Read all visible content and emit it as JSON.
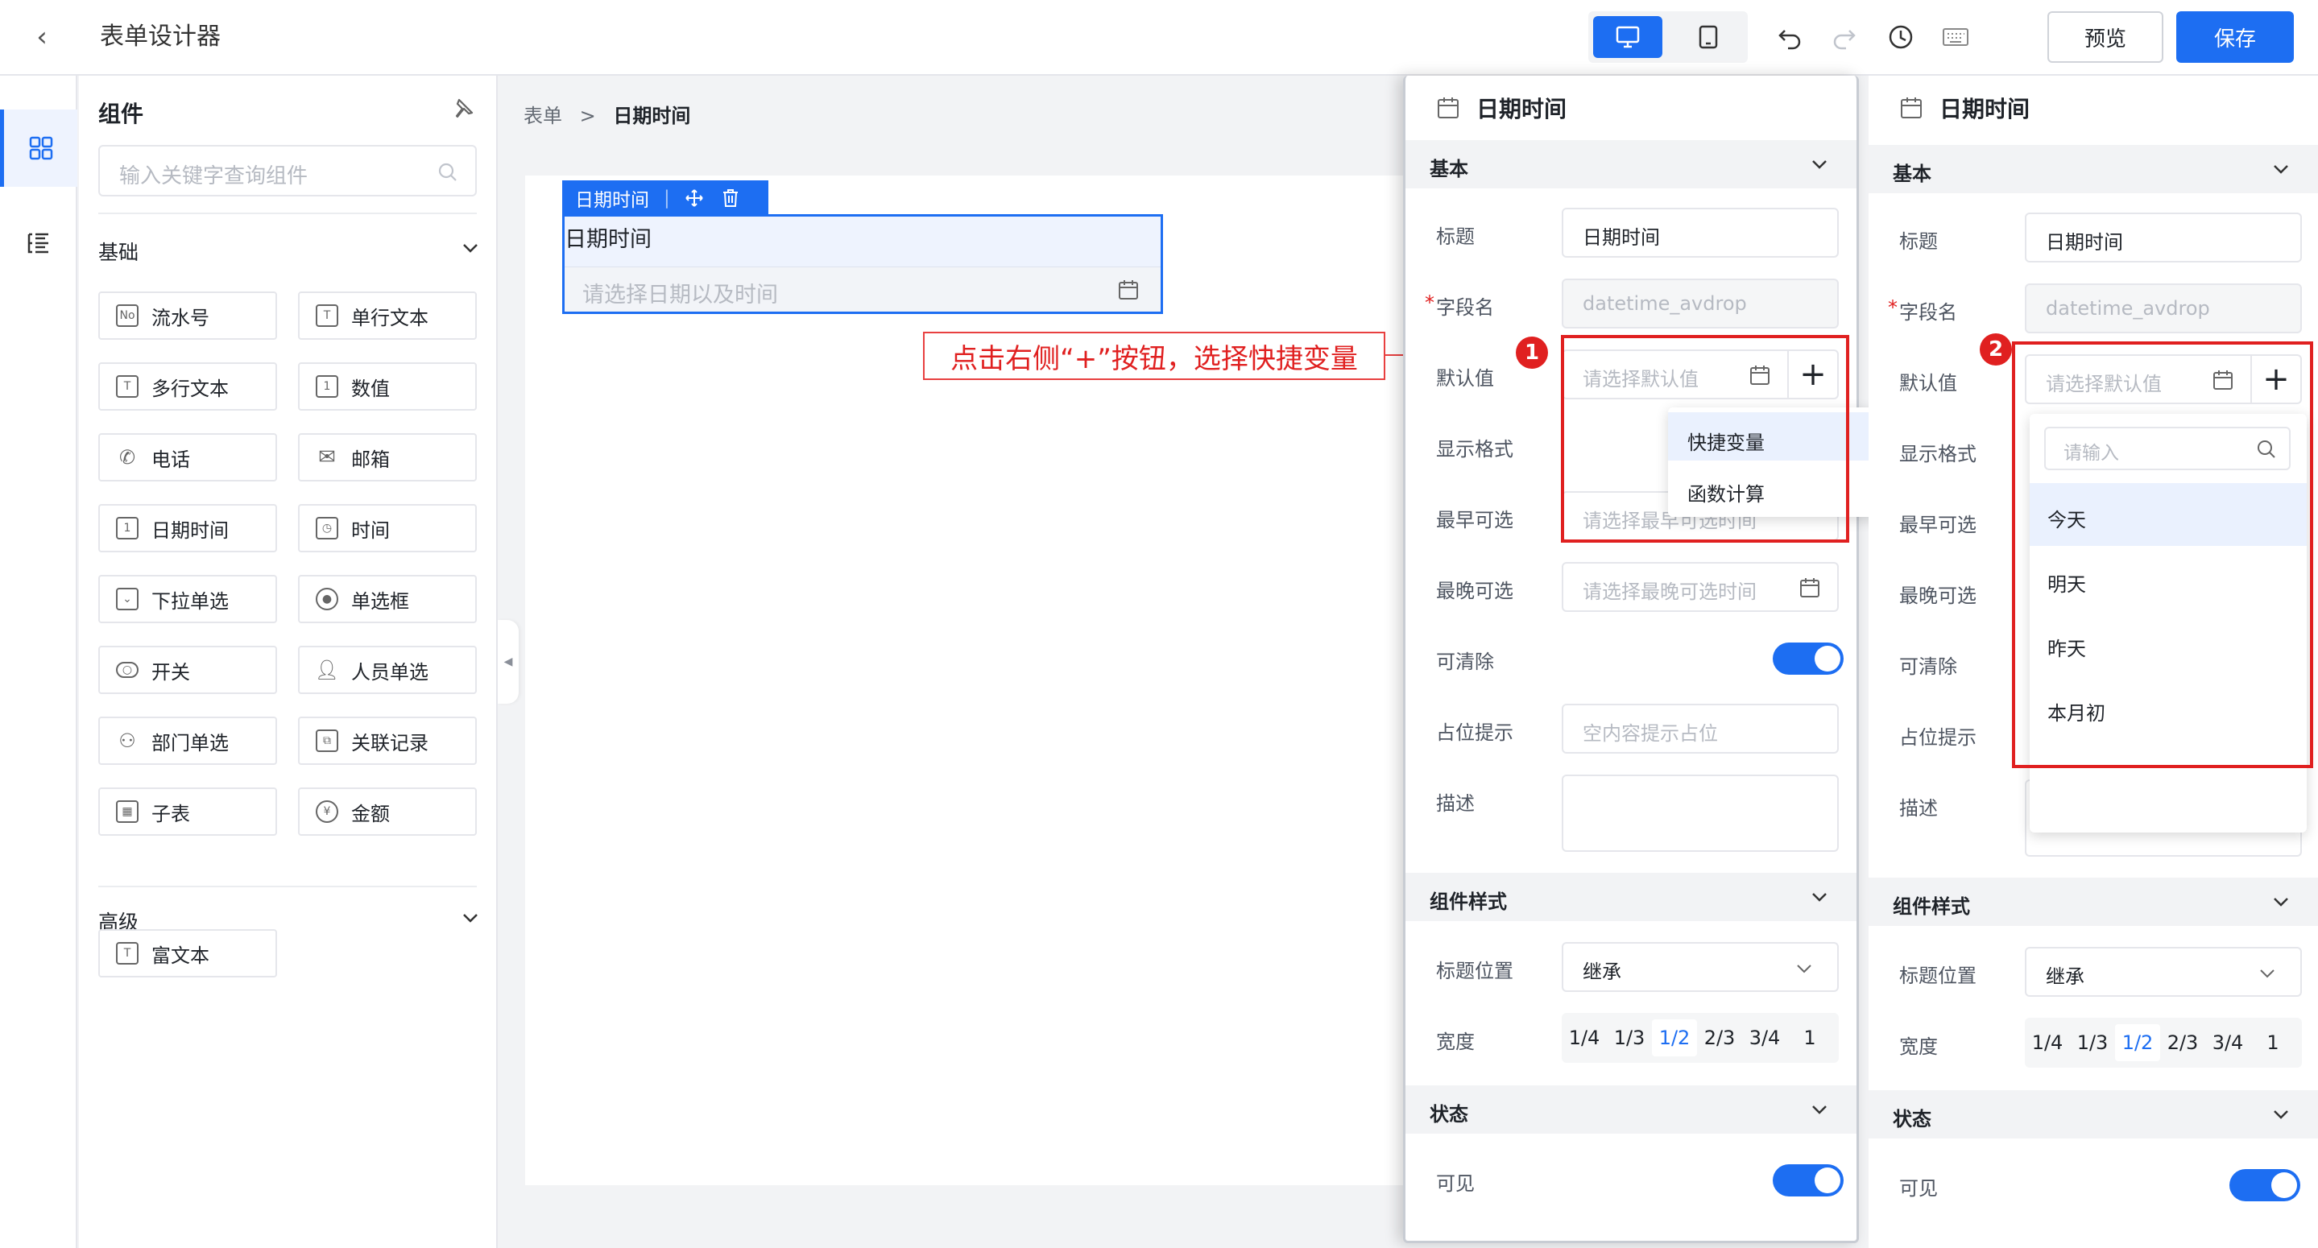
{
  "topbar": {
    "title": "表单设计器",
    "preview_label": "预览",
    "save_label": "保存"
  },
  "components": {
    "title": "组件",
    "search_placeholder": "输入关键字查询组件",
    "basic_section": "基础",
    "advanced_section": "高级",
    "basic_items": [
      "流水号",
      "单行文本",
      "多行文本",
      "数值",
      "电话",
      "邮箱",
      "日期时间",
      "时间",
      "下拉单选",
      "单选框",
      "开关",
      "人员单选",
      "部门单选",
      "关联记录",
      "子表",
      "金额"
    ],
    "advanced_items": [
      "富文本"
    ]
  },
  "canvas": {
    "breadcrumb_root": "表单",
    "breadcrumb_sep": ">",
    "breadcrumb_current": "日期时间",
    "field_tag": "日期时间",
    "field_label": "日期时间",
    "field_placeholder": "请选择日期以及时间"
  },
  "annotation": {
    "text": "点击右侧“+”按钮，选择快捷变量",
    "badge1": "1",
    "badge2": "2"
  },
  "props": {
    "header": "日期时间",
    "group_basic": "基本",
    "group_style": "组件样式",
    "group_state": "状态",
    "label_title": "标题",
    "label_field": "字段名",
    "label_default": "默认值",
    "label_format": "显示格式",
    "label_earliest": "最早可选",
    "label_latest": "最晚可选",
    "label_clearable": "可清除",
    "label_placeholder": "占位提示",
    "label_desc": "描述",
    "label_title_pos": "标题位置",
    "label_width": "宽度",
    "label_visible": "可见",
    "required_mark": "*",
    "title_value": "日期时间",
    "field_value": "datetime_avdrop",
    "default_placeholder": "请选择默认值",
    "earliest_placeholder": "请选择最早可选时间",
    "latest_placeholder": "请选择最晚可选时间",
    "placeholder_placeholder": "空内容提示占位",
    "title_pos_value": "继承",
    "width_options": [
      "1/4",
      "1/3",
      "1/2",
      "2/3",
      "3/4",
      "1"
    ],
    "width_selected": "1/2"
  },
  "menu1": {
    "items": [
      "快捷变量",
      "函数计算"
    ]
  },
  "menu2": {
    "search_placeholder": "请输入",
    "items": [
      "今天",
      "明天",
      "昨天",
      "本月初"
    ]
  },
  "colors": {
    "accent": "#1d6ef2",
    "annotation_red": "#e02020"
  }
}
